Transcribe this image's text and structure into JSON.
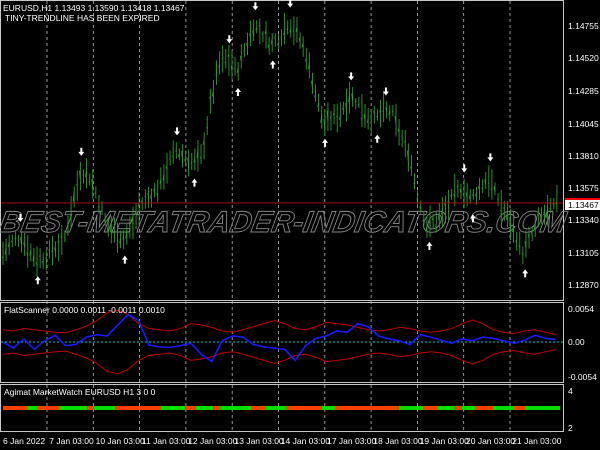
{
  "header": {
    "symbol_line": "EURUSD,H1  1.13493 1.13590 1.13418 1.13467",
    "alert": "TINY-TRENDLINE HAS BEEN EXPIRED"
  },
  "watermark": "BEST-METATRADER-INDICATORS.COM",
  "colors": {
    "bar": "#2e9e2e",
    "price_line": "#a01010",
    "ind_line": "#1a1aff",
    "band": "#c00000",
    "zero": "#00c8c8",
    "mw_up": "#00e000",
    "mw_down": "#ff4000"
  },
  "price_axis": {
    "labels": [
      "1.14755",
      "1.14520",
      "1.14285",
      "1.14045",
      "1.13810",
      "1.13575",
      "1.13340",
      "1.13105",
      "1.12870"
    ],
    "current": "1.13467",
    "current_value": 1.13467,
    "min": 1.1279,
    "max": 1.149
  },
  "time_axis": [
    "6 Jan 2022",
    "7 Jan 03:00",
    "10 Jan 03:00",
    "11 Jan 03:00",
    "12 Jan 03:00",
    "13 Jan 03:00",
    "14 Jan 03:00",
    "17 Jan 03:00",
    "18 Jan 03:00",
    "19 Jan 03:00",
    "20 Jan 03:00",
    "21 Jan 03:00"
  ],
  "chart_data": {
    "type": "line",
    "closes": [
      1.131,
      1.1318,
      1.1322,
      1.1312,
      1.1305,
      1.1308,
      1.1314,
      1.1318,
      1.1345,
      1.137,
      1.1366,
      1.135,
      1.133,
      1.1325,
      1.132,
      1.1332,
      1.1346,
      1.1352,
      1.1358,
      1.1374,
      1.1385,
      1.138,
      1.1376,
      1.1381,
      1.142,
      1.1448,
      1.1452,
      1.1442,
      1.146,
      1.1476,
      1.147,
      1.1462,
      1.1468,
      1.1478,
      1.147,
      1.1455,
      1.143,
      1.1405,
      1.1408,
      1.1412,
      1.1425,
      1.142,
      1.141,
      1.1408,
      1.1414,
      1.1412,
      1.1395,
      1.138,
      1.135,
      1.133,
      1.1334,
      1.134,
      1.1352,
      1.1358,
      1.135,
      1.1356,
      1.1366,
      1.1352,
      1.134,
      1.1328,
      1.131,
      1.1322,
      1.1336,
      1.134,
      1.1347
    ]
  },
  "flatscanner": {
    "title": "FlatScanner 0.0000 0.0011 -0.0011 0.0010",
    "axis": [
      "0.0054",
      "0.00",
      "-0.0054"
    ],
    "range": 0.0054,
    "values": [
      0.0,
      -0.001,
      0.0005,
      -0.0012,
      0.0002,
      0.0011,
      -0.0006,
      -0.0004,
      0.0008,
      0.0012,
      0.001,
      0.0028,
      0.0045,
      0.0035,
      -0.0005,
      -0.0008,
      -0.0009,
      -0.0006,
      -0.0002,
      -0.002,
      -0.0032,
      0.0002,
      0.001,
      0.0008,
      -0.0004,
      -0.0008,
      -0.001,
      -0.0012,
      -0.003,
      -0.0006,
      0.0006,
      0.001,
      0.0018,
      0.0016,
      0.003,
      0.0025,
      0.001,
      0.0005,
      0.0002,
      -0.0004,
      0.0012,
      0.0008,
      0.0003,
      -0.0002,
      0.0005,
      0.0002,
      0.0008,
      0.0006,
      0.0002,
      -0.0002,
      0.0003,
      0.0011,
      0.0006,
      0.0004
    ],
    "band": [
      0.002,
      0.0018,
      0.0022,
      0.002,
      0.0018,
      0.0016,
      0.0015,
      0.002,
      0.0026,
      0.0035,
      0.0048,
      0.0052,
      0.0045,
      0.003,
      0.0022,
      0.002,
      0.0018,
      0.0022,
      0.003,
      0.0028,
      0.0024,
      0.0018,
      0.0016,
      0.002,
      0.0025,
      0.003,
      0.0035,
      0.003,
      0.0022,
      0.002,
      0.0025,
      0.0032,
      0.003,
      0.0028,
      0.0024,
      0.002,
      0.0018,
      0.002,
      0.0024,
      0.0022,
      0.0018,
      0.0016,
      0.0018,
      0.0022,
      0.003,
      0.0036,
      0.003,
      0.002,
      0.0016,
      0.0014,
      0.0018,
      0.002,
      0.0016,
      0.0012
    ]
  },
  "marketwatch": {
    "title": "Agimat MarketWatch EURUSD H1  3 0 0",
    "axis": [
      "4",
      "2"
    ],
    "segments": [
      [
        "d",
        7
      ],
      [
        "u",
        3
      ],
      [
        "d",
        6
      ],
      [
        "u",
        8
      ],
      [
        "d",
        2
      ],
      [
        "u",
        6
      ],
      [
        "d",
        13
      ],
      [
        "u",
        7
      ],
      [
        "d",
        3
      ],
      [
        "u",
        5
      ],
      [
        "d",
        2
      ],
      [
        "u",
        9
      ],
      [
        "d",
        4
      ],
      [
        "u",
        6
      ],
      [
        "d",
        10
      ],
      [
        "u",
        4
      ],
      [
        "d",
        18
      ],
      [
        "u",
        7
      ],
      [
        "d",
        4
      ],
      [
        "u",
        5
      ],
      [
        "d",
        2
      ],
      [
        "u",
        4
      ],
      [
        "d",
        5
      ],
      [
        "u",
        6
      ],
      [
        "d",
        3
      ],
      [
        "u",
        10
      ]
    ]
  }
}
